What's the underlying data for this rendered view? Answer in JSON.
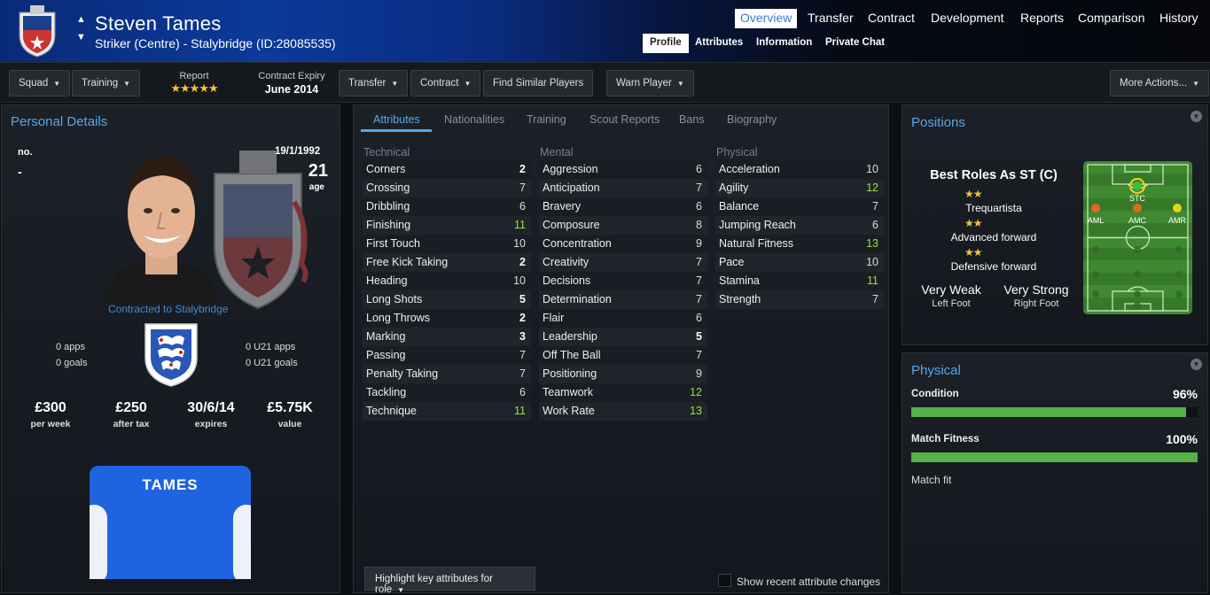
{
  "header": {
    "player_name": "Steven Tames",
    "player_subtitle": "Striker (Centre) - Stalybridge (ID:28085535)",
    "nav": [
      "Overview",
      "Transfer",
      "Contract",
      "Development",
      "Reports",
      "Comparison",
      "History"
    ],
    "subnav": [
      "Profile",
      "Attributes",
      "Information",
      "Private Chat"
    ]
  },
  "toolbar": {
    "squad": "Squad",
    "training": "Training",
    "report_label": "Report",
    "report_stars": "★★★★★",
    "contract_label": "Contract Expiry",
    "contract_value": "June 2014",
    "transfer": "Transfer",
    "contract": "Contract",
    "find_similar": "Find Similar Players",
    "warn_player": "Warn Player",
    "more_actions": "More Actions..."
  },
  "personal": {
    "title": "Personal Details",
    "no_label": "no.",
    "no_value": "-",
    "dob": "19/1/1992",
    "age": "21",
    "age_label": "age",
    "contracted": "Contracted to Stalybridge",
    "apps": "0 apps",
    "goals": "0 goals",
    "u21_apps": "0 U21 apps",
    "u21_goals": "0 U21 goals",
    "money": [
      {
        "value": "£300",
        "label": "per week"
      },
      {
        "value": "£250",
        "label": "after tax"
      },
      {
        "value": "30/6/14",
        "label": "expires"
      },
      {
        "value": "£5.75K",
        "label": "value"
      }
    ],
    "shirt_name": "TAMES"
  },
  "attributes": {
    "tabs": [
      "Attributes",
      "Nationalities",
      "Training",
      "Scout Reports",
      "Bans",
      "Biography"
    ],
    "technical_label": "Technical",
    "mental_label": "Mental",
    "physical_label": "Physical",
    "technical": [
      {
        "name": "Corners",
        "value": "2"
      },
      {
        "name": "Crossing",
        "value": "7"
      },
      {
        "name": "Dribbling",
        "value": "6"
      },
      {
        "name": "Finishing",
        "value": "11"
      },
      {
        "name": "First Touch",
        "value": "10"
      },
      {
        "name": "Free Kick Taking",
        "value": "2"
      },
      {
        "name": "Heading",
        "value": "10"
      },
      {
        "name": "Long Shots",
        "value": "5"
      },
      {
        "name": "Long Throws",
        "value": "2"
      },
      {
        "name": "Marking",
        "value": "3"
      },
      {
        "name": "Passing",
        "value": "7"
      },
      {
        "name": "Penalty Taking",
        "value": "7"
      },
      {
        "name": "Tackling",
        "value": "6"
      },
      {
        "name": "Technique",
        "value": "11"
      }
    ],
    "mental": [
      {
        "name": "Aggression",
        "value": "6"
      },
      {
        "name": "Anticipation",
        "value": "7"
      },
      {
        "name": "Bravery",
        "value": "6"
      },
      {
        "name": "Composure",
        "value": "8"
      },
      {
        "name": "Concentration",
        "value": "9"
      },
      {
        "name": "Creativity",
        "value": "7"
      },
      {
        "name": "Decisions",
        "value": "7"
      },
      {
        "name": "Determination",
        "value": "7"
      },
      {
        "name": "Flair",
        "value": "6"
      },
      {
        "name": "Leadership",
        "value": "5"
      },
      {
        "name": "Off The Ball",
        "value": "7"
      },
      {
        "name": "Positioning",
        "value": "9"
      },
      {
        "name": "Teamwork",
        "value": "12"
      },
      {
        "name": "Work Rate",
        "value": "13"
      }
    ],
    "physical": [
      {
        "name": "Acceleration",
        "value": "10"
      },
      {
        "name": "Agility",
        "value": "12"
      },
      {
        "name": "Balance",
        "value": "7"
      },
      {
        "name": "Jumping Reach",
        "value": "6"
      },
      {
        "name": "Natural Fitness",
        "value": "13"
      },
      {
        "name": "Pace",
        "value": "10"
      },
      {
        "name": "Stamina",
        "value": "11"
      },
      {
        "name": "Strength",
        "value": "7"
      }
    ],
    "highlight_button": "Highlight key attributes for role",
    "recent_changes": "Show recent attribute changes"
  },
  "positions": {
    "title": "Positions",
    "best_roles": "Best Roles As ST (C)",
    "roles": [
      {
        "name": "Trequartista",
        "stars": "★★"
      },
      {
        "name": "Advanced forward",
        "stars": "★★"
      },
      {
        "name": "Defensive forward",
        "stars": "★★"
      }
    ],
    "left_foot_value": "Very Weak",
    "left_foot_label": "Left Foot",
    "right_foot_value": "Very Strong",
    "right_foot_label": "Right Foot",
    "pitch_labels": [
      "STC",
      "AML",
      "AMC",
      "AMR"
    ],
    "colors": {
      "natural": "#35c23a",
      "accomplished": "#e8d21a",
      "unconvincing": "#e2691a"
    }
  },
  "physical": {
    "title": "Physical",
    "condition_label": "Condition",
    "condition_value": "96%",
    "condition_fraction": 0.96,
    "fitness_label": "Match Fitness",
    "fitness_value": "100%",
    "fitness_fraction": 1.0,
    "match_fit": "Match fit"
  }
}
